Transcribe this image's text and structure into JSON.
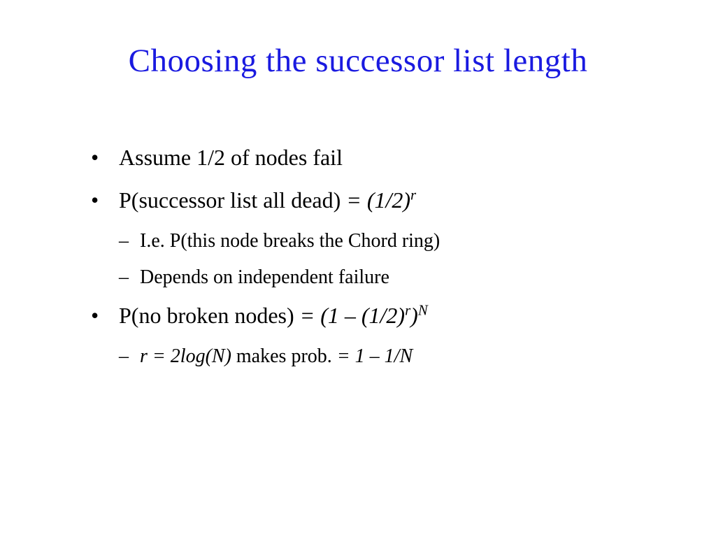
{
  "title": "Choosing the successor list length",
  "bullets": {
    "b1": {
      "text": "Assume 1/2 of nodes fail"
    },
    "b2": {
      "prefix": "P(successor list all dead) ",
      "eq": "= (1/2)",
      "sup": "r"
    },
    "b2_sub1": "I.e. P(this node breaks the Chord ring)",
    "b2_sub2": "Depends on independent failure",
    "b3": {
      "prefix": "P(no broken nodes) ",
      "eq1": "= (1 – (1/2)",
      "sup1": "r",
      "eq2": ")",
      "sup2": "N"
    },
    "b3_sub1": {
      "it1": "r = 2log(N)",
      "mid": " makes prob. ",
      "it2": "= 1 – 1/N"
    }
  },
  "markers": {
    "bullet": "•",
    "dash": "–"
  }
}
